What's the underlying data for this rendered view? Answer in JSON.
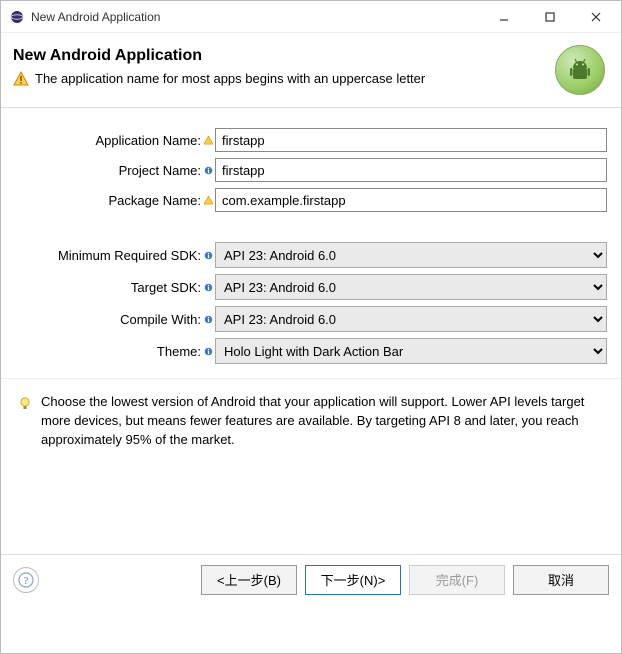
{
  "window": {
    "title": "New Android Application"
  },
  "header": {
    "title": "New Android Application",
    "warning": "The application name for most apps begins with an uppercase letter"
  },
  "form": {
    "appName": {
      "label": "Application Name:",
      "value": "firstapp"
    },
    "projectName": {
      "label": "Project Name:",
      "value": "firstapp"
    },
    "packageName": {
      "label": "Package Name:",
      "value": "com.example.firstapp"
    },
    "minSdk": {
      "label": "Minimum Required SDK:",
      "value": "API 23: Android 6.0"
    },
    "targetSdk": {
      "label": "Target SDK:",
      "value": "API 23: Android 6.0"
    },
    "compileWith": {
      "label": "Compile With:",
      "value": "API 23: Android 6.0"
    },
    "theme": {
      "label": "Theme:",
      "value": "Holo Light with Dark Action Bar"
    }
  },
  "hint": {
    "text": "Choose the lowest version of Android that your application will support. Lower API levels target more devices, but means fewer features are available. By targeting API 8 and later, you reach approximately 95% of the market."
  },
  "buttons": {
    "back": "<上一步(B)",
    "next": "下一步(N)>",
    "finish": "完成(F)",
    "cancel": "取消"
  }
}
